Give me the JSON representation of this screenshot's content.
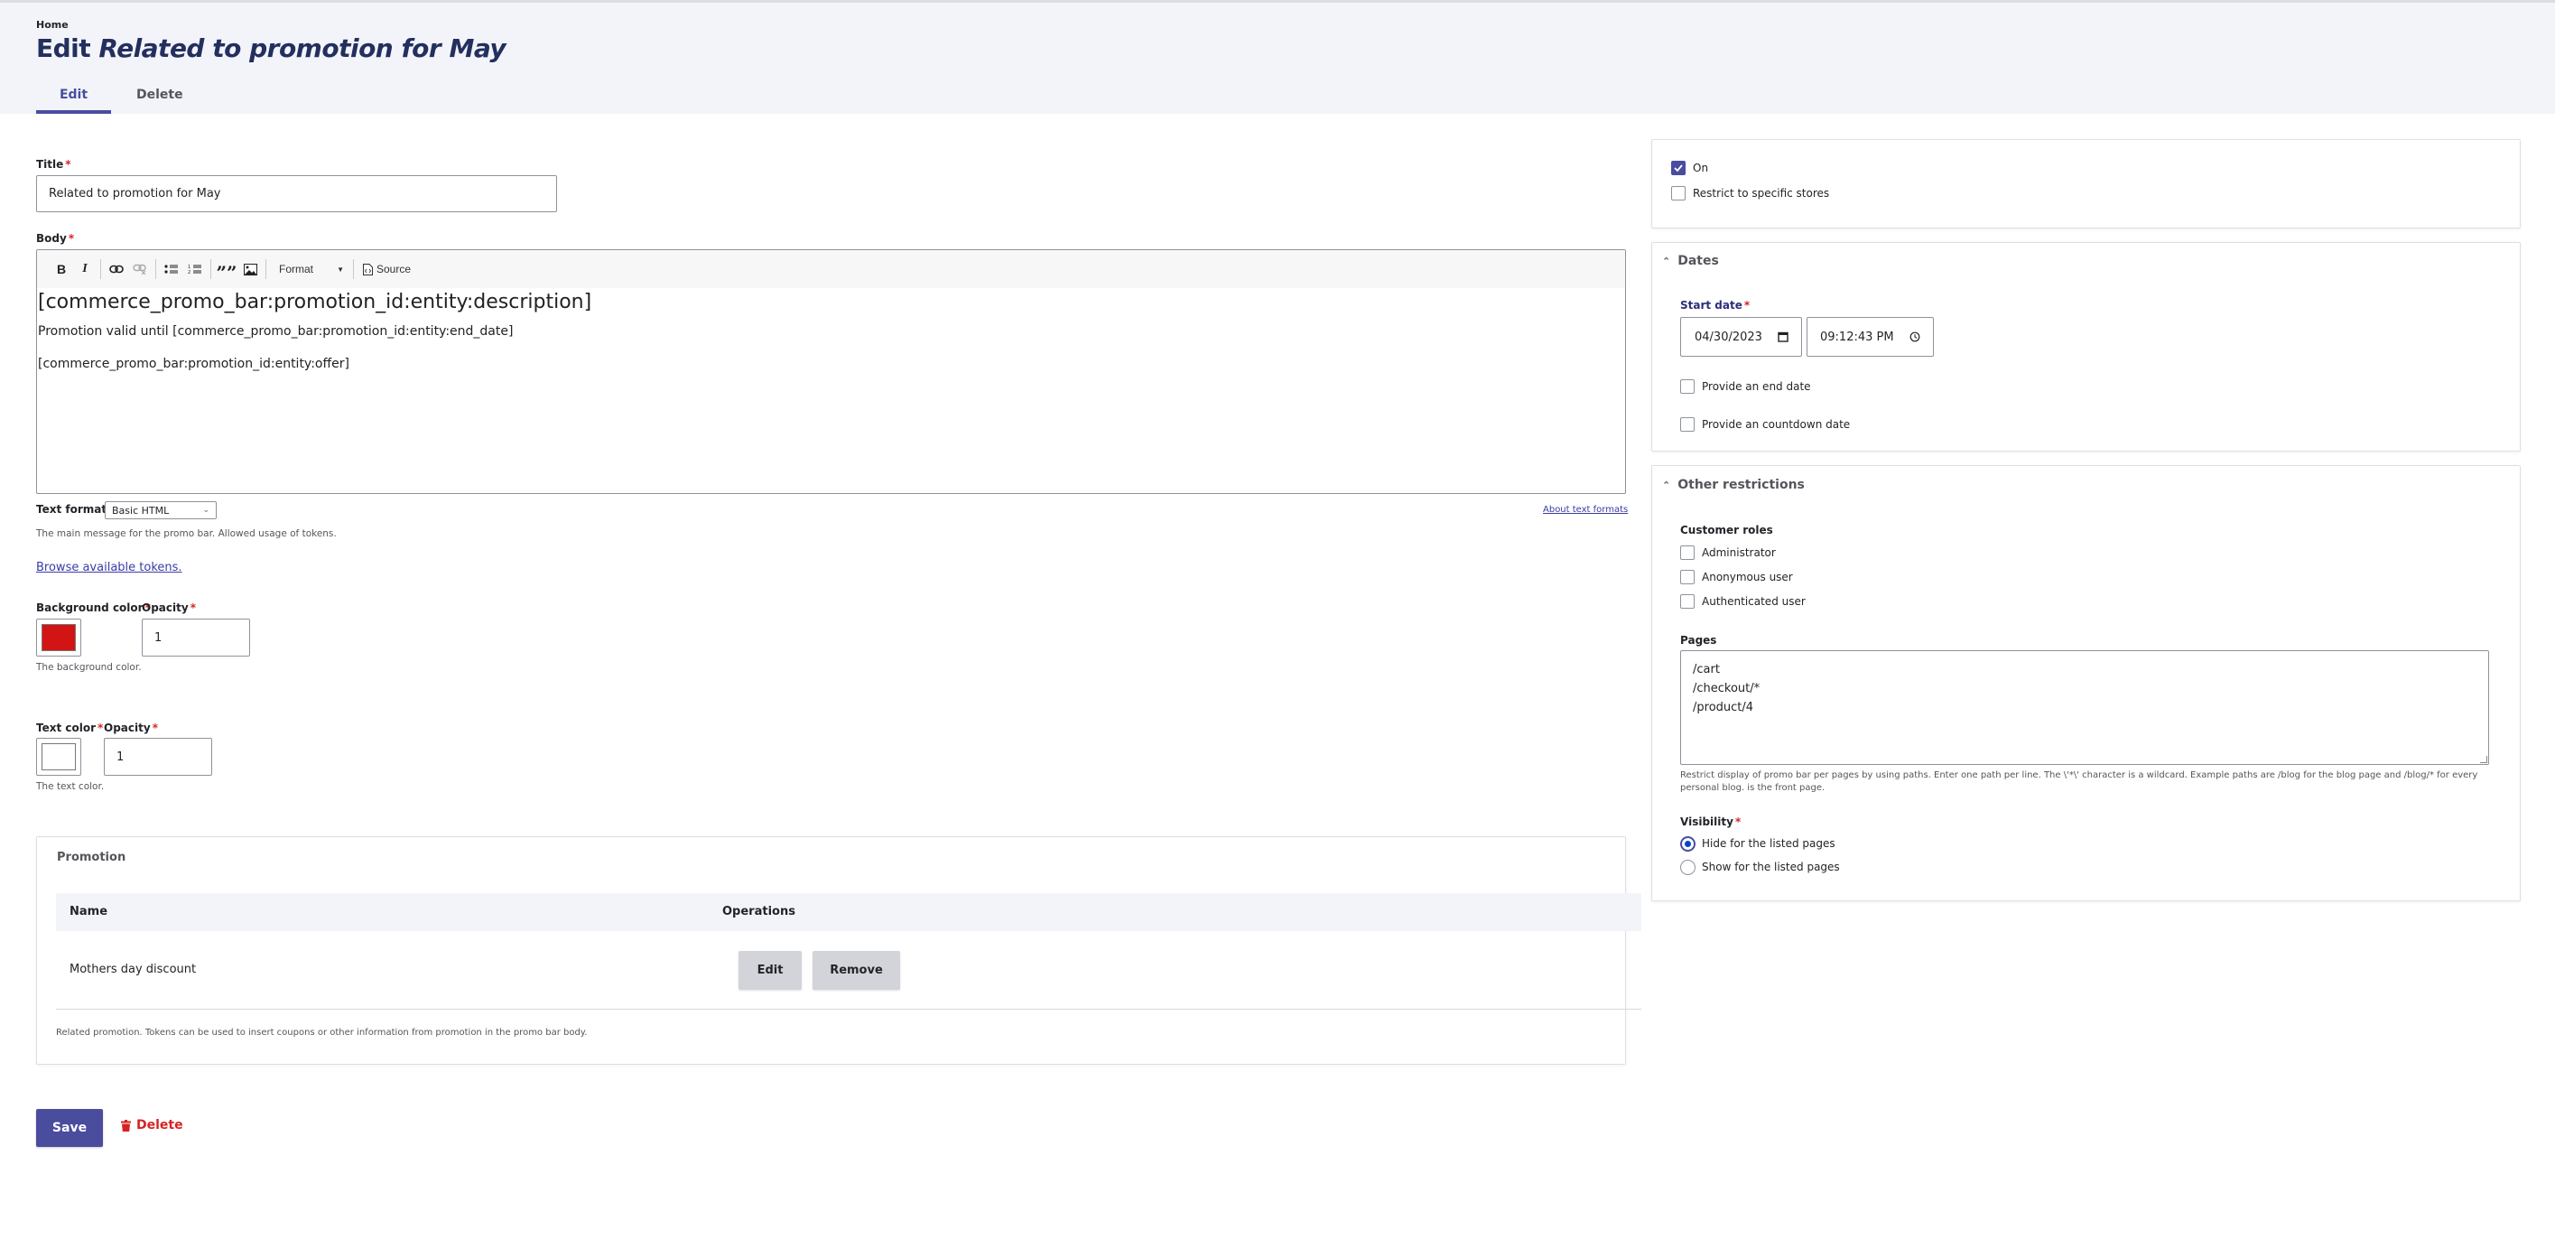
{
  "header": {
    "breadcrumb": "Home",
    "title_prefix": "Edit",
    "title_entity": "Related to promotion for May",
    "tabs": [
      {
        "label": "Edit",
        "active": true
      },
      {
        "label": "Delete",
        "active": false
      }
    ]
  },
  "form": {
    "title": {
      "label": "Title",
      "value": "Related to promotion for May"
    },
    "body": {
      "label": "Body",
      "toolbar": {
        "bold": "B",
        "italic": "I",
        "format_label": "Format",
        "source_label": "Source"
      },
      "content": {
        "heading": "[commerce_promo_bar:promotion_id:entity:description]",
        "paragraph1": "Promotion valid until [commerce_promo_bar:promotion_id:entity:end_date]",
        "paragraph2": "[commerce_promo_bar:promotion_id:entity:offer]"
      },
      "text_format_label": "Text format",
      "text_format_value": "Basic HTML",
      "about_formats_link": "About text formats",
      "description": "The main message for the promo bar. Allowed usage of tokens."
    },
    "browse_tokens_link": "Browse available tokens.",
    "background_color": {
      "label": "Background color",
      "value": "#d21414",
      "opacity_label": "Opacity",
      "opacity_value": "1",
      "description": "The background color."
    },
    "text_color": {
      "label": "Text color",
      "value": "#ffffff",
      "opacity_label": "Opacity",
      "opacity_value": "1",
      "description": "The text color."
    },
    "promotion": {
      "title": "Promotion",
      "columns": [
        "Name",
        "Operations"
      ],
      "rows": [
        {
          "name": "Mothers day discount",
          "edit_label": "Edit",
          "remove_label": "Remove"
        }
      ],
      "description": "Related promotion. Tokens can be used to insert coupons or other information from promotion in the promo bar body."
    },
    "actions": {
      "save_label": "Save",
      "delete_label": "Delete"
    }
  },
  "sidebar": {
    "status": {
      "on_label": "On",
      "on_checked": true,
      "restrict_label": "Restrict to specific stores",
      "restrict_checked": false
    },
    "dates": {
      "title": "Dates",
      "start_label": "Start date",
      "start_date": "04/30/2023",
      "start_time": "09:12:43 PM",
      "end_label": "Provide an end date",
      "end_checked": false,
      "countdown_label": "Provide an countdown date",
      "countdown_checked": false
    },
    "other": {
      "title": "Other restrictions",
      "roles_label": "Customer roles",
      "roles": [
        {
          "label": "Administrator",
          "checked": false
        },
        {
          "label": "Anonymous user",
          "checked": false
        },
        {
          "label": "Authenticated user",
          "checked": false
        }
      ],
      "pages_label": "Pages",
      "pages": [
        "/cart",
        "/checkout/*",
        "/product/4"
      ],
      "pages_description_line1": "Restrict display of promo bar per pages by using paths. Enter one path per line. The \\'*\\' character is a wildcard. Example paths are /blog for the blog page and /blog/* for every",
      "pages_description_line2": "personal blog. is the front page.",
      "visibility_label": "Visibility",
      "visibility_options": [
        {
          "label": "Hide for the listed pages",
          "selected": true
        },
        {
          "label": "Show for the listed pages",
          "selected": false
        }
      ]
    }
  },
  "colors": {
    "accent": "#4a4c9e",
    "title": "#232f5e",
    "danger": "#d72222",
    "header_bg": "#f3f4f9"
  }
}
